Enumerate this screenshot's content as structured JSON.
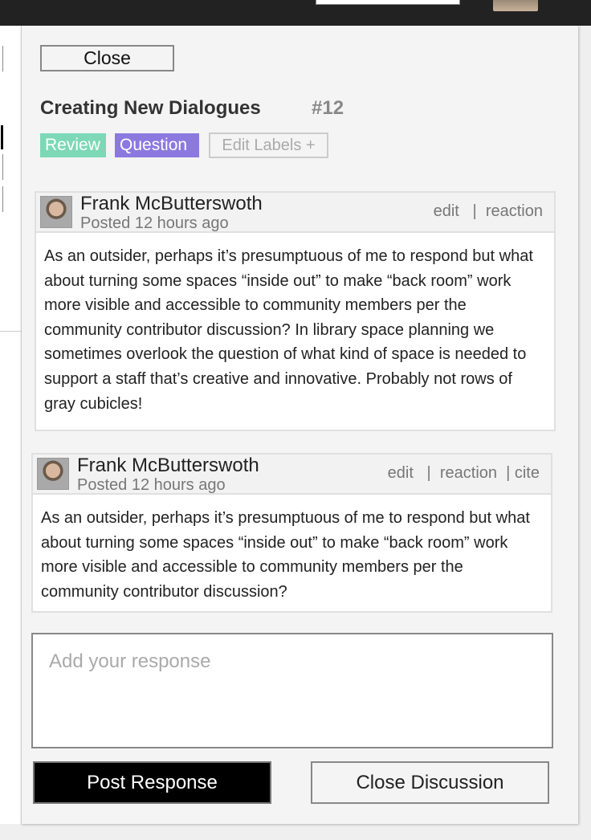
{
  "topbar": {
    "avatar_icon": "user-avatar-icon"
  },
  "panel": {
    "close_label": "Close",
    "title": "Creating New Dialogues",
    "issue_number": "#12",
    "labels": [
      {
        "text": "Review",
        "color": "#7dd8b8"
      },
      {
        "text": "Question",
        "color": "#8b79e0"
      }
    ],
    "edit_labels": "Edit Labels +"
  },
  "comments": [
    {
      "author": "Frank McButterswoth",
      "posted": "Posted 12 hours ago",
      "actions": "edit   |  reaction",
      "body": "As an outsider, perhaps it’s presumptuous of me to respond but what about turning some spaces “inside out” to make “back room” work more visible and accessible to community members per the community contributor discussion? In library space planning we sometimes overlook the question of what kind of space is needed to support a staff that’s creative and innovative. Probably not rows of gray cubicles!"
    },
    {
      "author": "Frank McButterswoth",
      "posted": "Posted 12 hours ago",
      "actions": "edit   |  reaction  | cite",
      "body": "As an outsider, perhaps it’s presumptuous of me to respond but what about turning some spaces “inside out” to make “back room” work more visible and accessible to community members per the community contributor discussion?"
    }
  ],
  "response": {
    "placeholder": "Add your response",
    "value": ""
  },
  "buttons": {
    "post": "Post Response",
    "close_discussion": "Close Discussion"
  },
  "colors": {
    "topbar": "#222222",
    "post_button": "#000000",
    "panel_bg": "#f4f4f4"
  }
}
